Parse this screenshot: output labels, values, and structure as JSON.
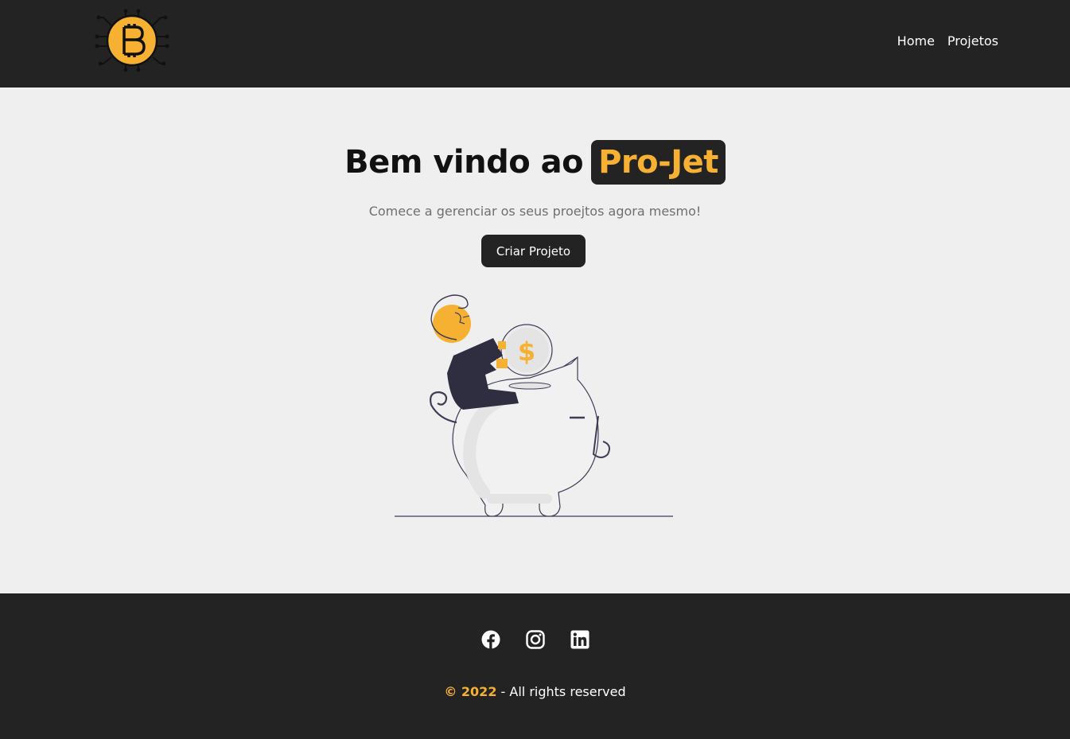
{
  "brand": {
    "logo_icon": "bitcoin-chip-icon",
    "accent": "#f6b132",
    "dark": "#232323"
  },
  "nav": {
    "items": [
      {
        "label": "Home"
      },
      {
        "label": "Projetos"
      }
    ]
  },
  "hero": {
    "title_prefix": "Bem vindo ao",
    "title_highlight": "Pro-Jet",
    "subtitle": "Comece a gerenciar os seus proejtos agora mesmo!",
    "cta_label": "Criar Projeto",
    "illustration": "person-saving-coin-in-piggy-bank",
    "coin_symbol": "$"
  },
  "footer": {
    "socials": [
      {
        "icon": "facebook-icon"
      },
      {
        "icon": "instagram-icon"
      },
      {
        "icon": "linkedin-icon"
      }
    ],
    "copyright_year": "© 2022",
    "copyright_text": " - All rights reserved"
  }
}
